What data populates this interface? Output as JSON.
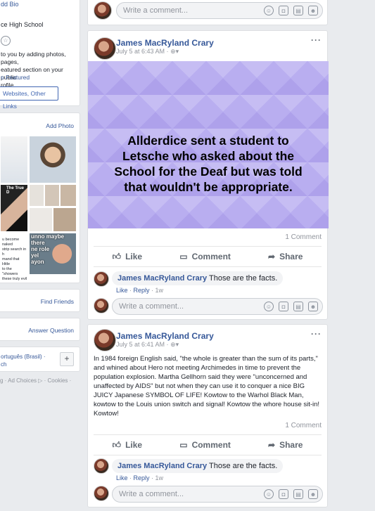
{
  "sidebar": {
    "intro_title_fragment": "dd Bio",
    "school": "ce High School",
    "featured_text": [
      " to you by adding photos, pages,",
      "eatured section on your public",
      "rofile."
    ],
    "featured_link": "o Featured",
    "links_button": "Websites, Other Links",
    "add_photo": "Add Photo",
    "meme_captions": [
      "The True D",
      "unno maybe there",
      "ne role",
      "yel",
      "ayon"
    ],
    "naked_text": [
      "u become naked",
      "strip search in h",
      "mand that Hitle",
      "to the \"showers",
      "these truly evil"
    ],
    "find_friends": "Find Friends",
    "answer_question": "Answer Question",
    "language": "ortuguês (Brasil) ·",
    "language2": "ch",
    "plus": "+",
    "footer": "g · Ad Choices ▷ · Cookies ·"
  },
  "top_comment_input": {
    "placeholder": "Write a comment..."
  },
  "posts": [
    {
      "author": "James MacRyland Crary",
      "time": "July 5 at 6:43 AM ·",
      "image_text": "Allderdice sent a student to Letsche who asked about the School for the Deaf but was told that wouldn't be appropriate.",
      "comment_count": "1 Comment",
      "actions": {
        "like": "Like",
        "comment": "Comment",
        "share": "Share"
      },
      "comment": {
        "author": "James MacRyland Crary",
        "text": "Those are the facts.",
        "like": "Like",
        "reply": "Reply",
        "age": "1w"
      },
      "input_placeholder": "Write a comment..."
    },
    {
      "author": "James MacRyland Crary",
      "time": "July 5 at 6:41 AM ·",
      "body": "In 1984 foreign English said, \"the whole is greater than the sum of its parts,\" and whined about Hero not meeting Archimedes in time to prevent the population explosion. Martha Gellhorn said they were \"unconcerned and unaffected by AIDS\" but not when they can use it to conquer a nice BIG JUICY Japanese SYMBOL OF LIFE! Kowtow to the Warhol Black Man, kowtow to the Louis union switch and signal! Kowtow the whore house sit-in! Kowtow!",
      "comment_count": "1 Comment",
      "actions": {
        "like": "Like",
        "comment": "Comment",
        "share": "Share"
      },
      "comment": {
        "author": "James MacRyland Crary",
        "text": "Those are the facts.",
        "like": "Like",
        "reply": "Reply",
        "age": "1w"
      },
      "input_placeholder": "Write a comment..."
    }
  ],
  "colors": {
    "link": "#365899",
    "background": "#e9ebee",
    "image_bg": "#b9aef0"
  }
}
